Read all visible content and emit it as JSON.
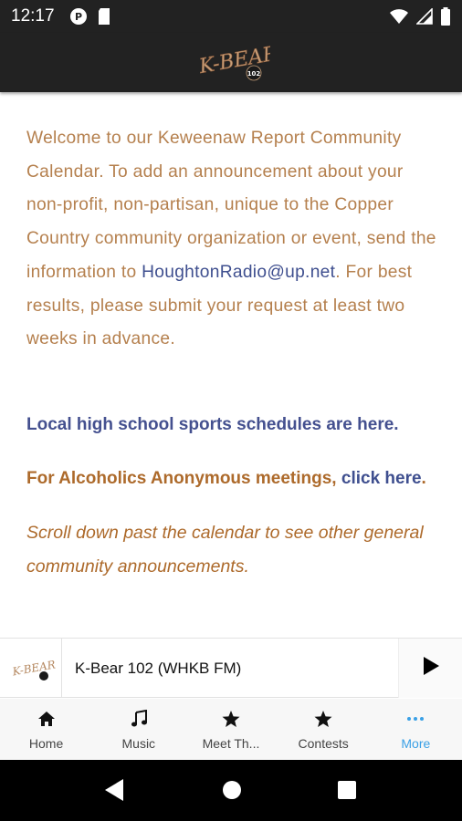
{
  "status_bar": {
    "time": "12:17"
  },
  "header": {
    "logo_text": "K-BEAR",
    "logo_sub": "102"
  },
  "content": {
    "intro_part1": "Welcome to our Keweenaw Report Community Calendar. To add an announcement about your non-profit, non-partisan, unique to the Copper Country community organization or event, send the information to",
    "intro_email": "HoughtonRadio@up.net",
    "intro_part2": ". For best results, please submit your request at least two weeks in advance.",
    "sports_link": "Local high school sports schedules are here.",
    "aa_text": "For Alcoholics Anonymous meetings,",
    "aa_link": "click here",
    "aa_period": ".",
    "scroll_note": "Scroll down past the calendar to see other general community announcements."
  },
  "player": {
    "station": "K-Bear 102 (WHKB FM)"
  },
  "tabs": [
    {
      "label": "Home",
      "icon": "home-icon"
    },
    {
      "label": "Music",
      "icon": "music-note-icon"
    },
    {
      "label": "Meet Th...",
      "icon": "star-icon"
    },
    {
      "label": "Contests",
      "icon": "star-icon"
    },
    {
      "label": "More",
      "icon": "more-dots-icon",
      "active": true
    }
  ],
  "colors": {
    "body_text": "#b5804e",
    "link": "#44508f",
    "emphasis": "#ad6a2b",
    "active_tab": "#3aa0e6",
    "header_bg": "#222222"
  }
}
